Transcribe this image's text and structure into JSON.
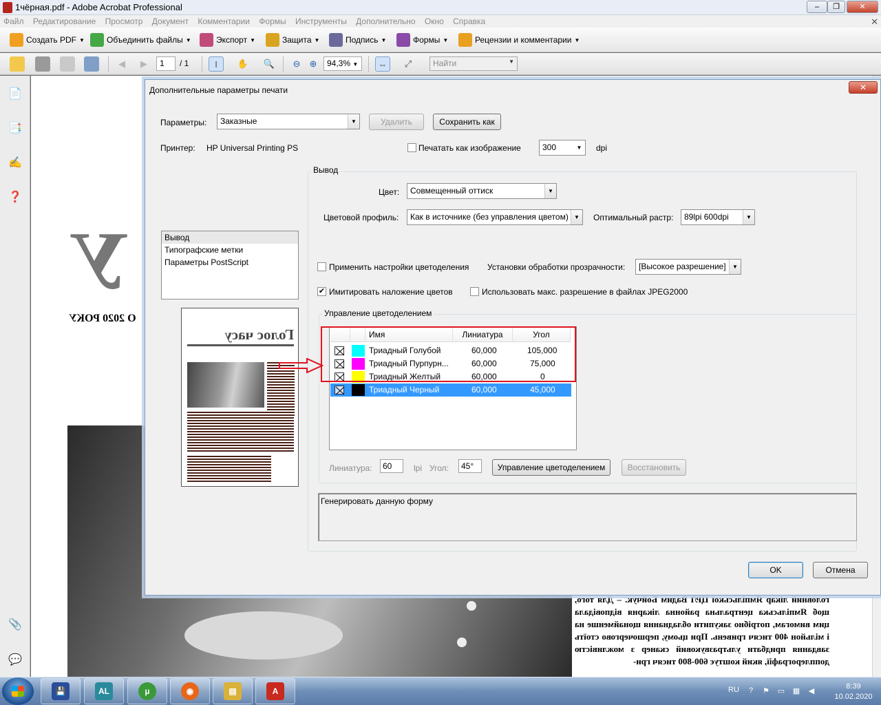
{
  "window": {
    "title": "1чёрная.pdf - Adobe Acrobat Professional",
    "min": "–",
    "max": "❐",
    "close": "✕"
  },
  "menubar": [
    "Файл",
    "Редактирование",
    "Просмотр",
    "Документ",
    "Комментарии",
    "Формы",
    "Инструменты",
    "Дополнительно",
    "Окно",
    "Справка"
  ],
  "doc_close": "✕",
  "tasks": [
    {
      "label": "Создать PDF",
      "icon": "create-pdf-icon",
      "color": "#f0a020"
    },
    {
      "label": "Объединить файлы",
      "icon": "combine-files-icon",
      "color": "#45a845"
    },
    {
      "label": "Экспорт",
      "icon": "export-icon",
      "color": "#c04a7a"
    },
    {
      "label": "Защита",
      "icon": "lock-icon",
      "color": "#d9a520"
    },
    {
      "label": "Подпись",
      "icon": "pen-icon",
      "color": "#6a6a9a"
    },
    {
      "label": "Формы",
      "icon": "forms-icon",
      "color": "#8a4aa8"
    },
    {
      "label": "Рецензии и комментарии",
      "icon": "review-icon",
      "color": "#e8a020"
    }
  ],
  "nav": {
    "page": "1",
    "total": "/ 1",
    "zoom": "94,3%",
    "find_placeholder": "Найти"
  },
  "document": {
    "big_letter": "У",
    "year_line": "О 2020 РОКУ",
    "body_text": "головний лікар Ямпільської ЦРЛ Вадим Бойчук. – Для того, щоб Ямпільська центральна районна лікарня відповідала цим вимогам, потрібно закупити обладнання щонайменше на і мільйон 400 тисяч гривень. При цьому, першочергово стоїть завдання придбати ультразвуковий сканер з можливістю допплерографії, який коштує 600-800 тисяч гри-"
  },
  "dialog": {
    "title": "Дополнительные параметры печати",
    "close": "✕",
    "params_label": "Параметры:",
    "params_value": "Заказные",
    "delete_btn": "Удалить",
    "save_as_btn": "Сохранить как",
    "printer_label": "Принтер:",
    "printer_value": "HP Universal Printing PS",
    "print_as_image_label": "Печатать как изображение",
    "print_as_image_checked": false,
    "dpi_value": "300",
    "dpi_unit": "dpi",
    "nav_items": [
      "Вывод",
      "Типографские метки",
      "Параметры PostScript"
    ],
    "preview_masthead": "Голос часу",
    "output": {
      "group_title": "Вывод",
      "color_label": "Цвет:",
      "color_value": "Совмещенный оттиск",
      "profile_label": "Цветовой профиль:",
      "profile_value": "Как в источнике (без управления цветом)",
      "raster_label": "Оптимальный растр:",
      "raster_value": "89lpi 600dpi",
      "apply_sep_label": "Применить настройки цветоделения",
      "apply_sep_checked": false,
      "transparency_label": "Установки обработки прозрачности:",
      "transparency_value": "[Высокое разрешение]",
      "simulate_label": "Имитировать наложение цветов",
      "simulate_checked": true,
      "jpeg2000_label": "Использовать макс. разрешение в файлах JPEG2000",
      "jpeg2000_checked": false
    },
    "separation": {
      "group_title": "Управление цветоделением",
      "headers": [
        "Имя",
        "Линиатура",
        "Угол"
      ],
      "rows": [
        {
          "name": "Триадный Голубой",
          "lpi": "60,000",
          "angle": "105,000",
          "color": "#00ffff",
          "selected": false
        },
        {
          "name": "Триадный Пурпурн...",
          "lpi": "60,000",
          "angle": "75,000",
          "color": "#ff00ff",
          "selected": false
        },
        {
          "name": "Триадный Желтый",
          "lpi": "60,000",
          "angle": "0",
          "color": "#ffff00",
          "selected": false
        },
        {
          "name": "Триадный Черный",
          "lpi": "60,000",
          "angle": "45,000",
          "color": "#000000",
          "selected": true
        }
      ],
      "lpi_label": "Линиатура:",
      "lpi_value": "60",
      "lpi_unit": "lpi",
      "angle_label": "Угол:",
      "angle_value": "45°",
      "manage_btn": "Управление цветоделением",
      "restore_btn": "Восстановить"
    },
    "description": "Генерировать данную форму",
    "ok_btn": "OK",
    "cancel_btn": "Отмена"
  },
  "annotation": {
    "highlight_color": "#e0141e"
  },
  "taskbar": {
    "apps": [
      {
        "icon": "floppy-icon",
        "color": "#2a4e9c",
        "glyph": "💾"
      },
      {
        "icon": "al-app-icon",
        "color": "#2a8a9c",
        "glyph": "AL"
      },
      {
        "icon": "utorrent-icon",
        "color": "#3a9a3a",
        "glyph": "µ"
      },
      {
        "icon": "firefox-icon",
        "color": "#e8661a",
        "glyph": "◉"
      },
      {
        "icon": "file-manager-icon",
        "color": "#d9b23a",
        "glyph": "▤"
      },
      {
        "icon": "acrobat-icon",
        "color": "#c92a1f",
        "glyph": "A"
      }
    ],
    "lang": "RU",
    "time": "8:39",
    "date": "10.02.2020"
  }
}
